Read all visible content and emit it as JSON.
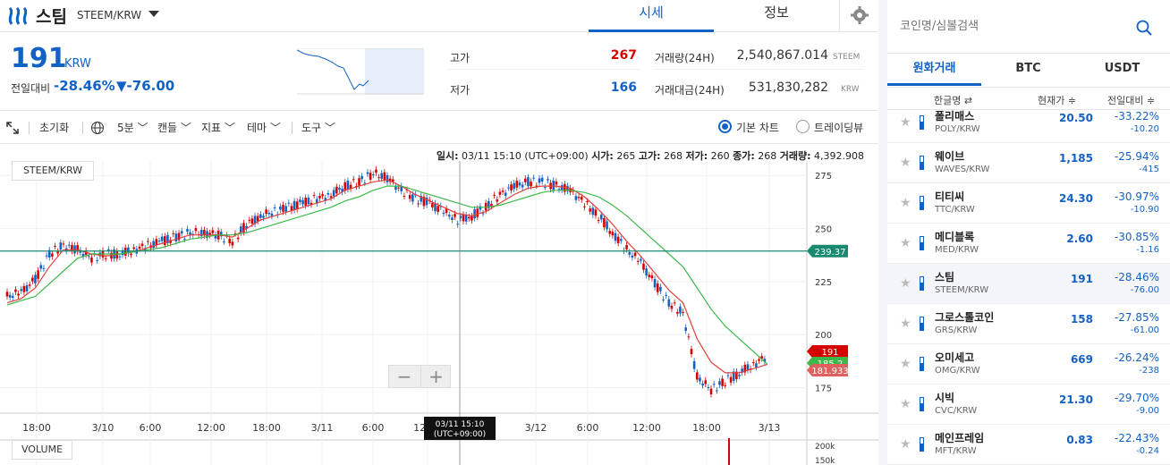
{
  "header": {
    "coin_name": "스팀",
    "coin_pair": "STEEM/KRW",
    "tabs": [
      "시세",
      "정보"
    ]
  },
  "summary": {
    "price": "191",
    "price_unit": "KRW",
    "change_label": "전일대비",
    "change_pct": "-28.46%",
    "change_amt": "▼-76.00",
    "high_label": "고가",
    "high": "267",
    "low_label": "저가",
    "low": "166",
    "volume_label": "거래량(24H)",
    "volume": "2,540,867.014",
    "volume_unit": "STEEM",
    "amount_label": "거래대금(24H)",
    "amount": "531,830,282",
    "amount_unit": "KRW"
  },
  "toolbar": {
    "reset": "초기화",
    "interval": "5분",
    "candle": "캔들",
    "indicator": "지표",
    "theme": "테마",
    "tools": "도구",
    "basic_chart": "기본 차트",
    "tradingview": "트레이딩뷰"
  },
  "chart_info": {
    "date_label": "일시:",
    "date": "03/11 15:10 (UTC+09:00)",
    "open_label": "시가:",
    "open": "265",
    "high_label": "고가:",
    "high": "268",
    "low_label": "저가:",
    "low": "260",
    "close_label": "종가:",
    "close": "268",
    "vol_label": "거래량:",
    "vol": "4,392.908"
  },
  "chart_labels": {
    "pair": "STEEM/KRW",
    "volume": "VOLUME",
    "crosshair_time": "03/11 15:10",
    "crosshair_tz": "(UTC+09:00)",
    "hline_price": "239.37",
    "last_price": "191",
    "ma_price": "185.2",
    "ma2_price": "181.933",
    "vol_ticks": [
      "200k",
      "150k"
    ]
  },
  "chart_data": {
    "type": "line",
    "x_ticks": [
      "18:00",
      "3/10",
      "6:00",
      "12:00",
      "18:00",
      "3/11",
      "6:00",
      "12:00",
      "3/12",
      "6:00",
      "12:00",
      "18:00",
      "3/13"
    ],
    "y_ticks": [
      275,
      250,
      225,
      200,
      175
    ],
    "ylim": [
      163,
      281
    ],
    "series": [
      {
        "values": [
          218,
          220,
          226,
          238,
          242,
          240,
          236,
          238,
          238,
          240,
          242,
          244,
          246,
          248,
          248,
          247,
          244,
          252,
          256,
          258,
          260,
          262,
          264,
          266,
          270,
          272,
          276,
          274,
          268,
          264,
          262,
          258,
          254,
          256,
          260,
          266,
          270,
          272,
          272,
          270,
          268,
          262,
          256,
          248,
          240,
          234,
          224,
          215,
          210,
          180,
          174,
          178,
          182,
          186,
          190
        ]
      },
      {
        "values": [
          215,
          217,
          222,
          232,
          240,
          240,
          238,
          237,
          238,
          239,
          241,
          243,
          245,
          247,
          247,
          247,
          246,
          250,
          254,
          256,
          258,
          260,
          262,
          264,
          268,
          270,
          272,
          273,
          270,
          266,
          263,
          260,
          257,
          256,
          258,
          262,
          266,
          269,
          270,
          270,
          269,
          265,
          259,
          252,
          244,
          237,
          229,
          221,
          215,
          198,
          187,
          182,
          182,
          184,
          186
        ]
      },
      {
        "values": [
          214,
          216,
          218,
          224,
          230,
          236,
          238,
          238,
          238,
          239,
          240,
          241,
          243,
          245,
          246,
          247,
          247,
          248,
          250,
          252,
          254,
          256,
          258,
          260,
          263,
          265,
          268,
          270,
          270,
          268,
          266,
          264,
          262,
          260,
          260,
          261,
          263,
          265,
          267,
          268,
          268,
          267,
          265,
          261,
          256,
          250,
          244,
          238,
          232,
          222,
          212,
          204,
          198,
          192,
          186
        ]
      }
    ],
    "xlabel": "",
    "ylabel": ""
  },
  "search": {
    "placeholder": "코인명/심볼검색"
  },
  "market_tabs": [
    "원화거래",
    "BTC",
    "USDT"
  ],
  "list_header": {
    "name": "한글명 ⇄",
    "price": "현재가 ≑",
    "change": "전일대비 ≑"
  },
  "coins": [
    {
      "name": "폴리매스",
      "pair": "POLY/KRW",
      "price": "20.50",
      "pct": "-33.22%",
      "amt": "-10.20"
    },
    {
      "name": "웨이브",
      "pair": "WAVES/KRW",
      "price": "1,185",
      "pct": "-25.94%",
      "amt": "-415"
    },
    {
      "name": "티티씨",
      "pair": "TTC/KRW",
      "price": "24.30",
      "pct": "-30.97%",
      "amt": "-10.90"
    },
    {
      "name": "메디블록",
      "pair": "MED/KRW",
      "price": "2.60",
      "pct": "-30.85%",
      "amt": "-1.16"
    },
    {
      "name": "스팀",
      "pair": "STEEM/KRW",
      "price": "191",
      "pct": "-28.46%",
      "amt": "-76.00"
    },
    {
      "name": "그로스톨코인",
      "pair": "GRS/KRW",
      "price": "158",
      "pct": "-27.85%",
      "amt": "-61.00"
    },
    {
      "name": "오미세고",
      "pair": "OMG/KRW",
      "price": "669",
      "pct": "-26.24%",
      "amt": "-238"
    },
    {
      "name": "시빅",
      "pair": "CVC/KRW",
      "price": "21.30",
      "pct": "-29.70%",
      "amt": "-9.00"
    },
    {
      "name": "메인프레임",
      "pair": "MFT/KRW",
      "price": "0.83",
      "pct": "-22.43%",
      "amt": "-0.24"
    }
  ],
  "colors": {
    "accent": "#1261c4",
    "up": "#d60000",
    "down": "#1261c4",
    "ma_short": "#e0403a",
    "ma_long": "#3db84a",
    "hline": "#1a8a6e"
  }
}
